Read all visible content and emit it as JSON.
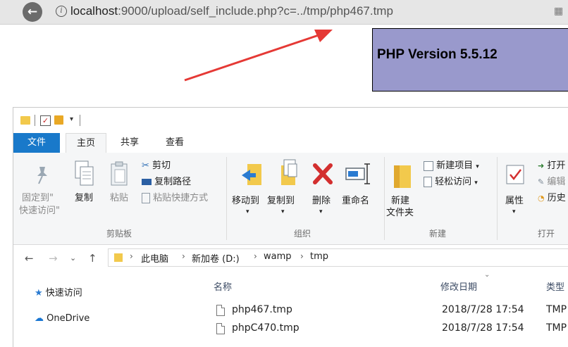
{
  "browser": {
    "url_host": "localhost",
    "url_rest": ":9000/upload/self_include.php?c=../tmp/php467.tmp",
    "back_glyph": "←",
    "info_glyph": "i",
    "qr_glyph": "▦"
  },
  "php_info": {
    "version_text": "PHP Version 5.5.12",
    "background_color": "#9999cc"
  },
  "annotation": {
    "arrow_color": "#e53935"
  },
  "explorer": {
    "tabs": [
      "文件",
      "主页",
      "共享",
      "查看"
    ],
    "ribbon": {
      "clipboard": {
        "pin_label_1": "固定到\"",
        "pin_label_2": "快速访问\"",
        "copy_label": "复制",
        "paste_label": "粘贴",
        "cut_label": "剪切",
        "copy_path_label": "复制路径",
        "paste_shortcut_label": "粘贴快捷方式",
        "group_label": "剪贴板"
      },
      "organize": {
        "move_to_label": "移动到",
        "copy_to_label": "复制到",
        "delete_label": "删除",
        "rename_label": "重命名",
        "group_label": "组织"
      },
      "new": {
        "new_item_label": "新建项目",
        "easy_access_label": "轻松访问",
        "new_folder_label_1": "新建",
        "new_folder_label_2": "文件夹",
        "group_label": "新建"
      },
      "open": {
        "properties_label": "属性",
        "open_label": "打开",
        "edit_label": "编辑",
        "history_label": "历史",
        "group_label": "打开"
      }
    },
    "address": {
      "crumbs": [
        "此电脑",
        "新加卷 (D:)",
        "wamp",
        "tmp"
      ]
    },
    "nav_pane": {
      "quick_access": "快速访问",
      "onedrive": "OneDrive"
    },
    "columns": {
      "name": "名称",
      "modified": "修改日期",
      "type": "类型"
    },
    "files": [
      {
        "name": "php467.tmp",
        "modified": "2018/7/28 17:54",
        "type": "TMP"
      },
      {
        "name": "phpC470.tmp",
        "modified": "2018/7/28 17:54",
        "type": "TMP"
      }
    ]
  }
}
